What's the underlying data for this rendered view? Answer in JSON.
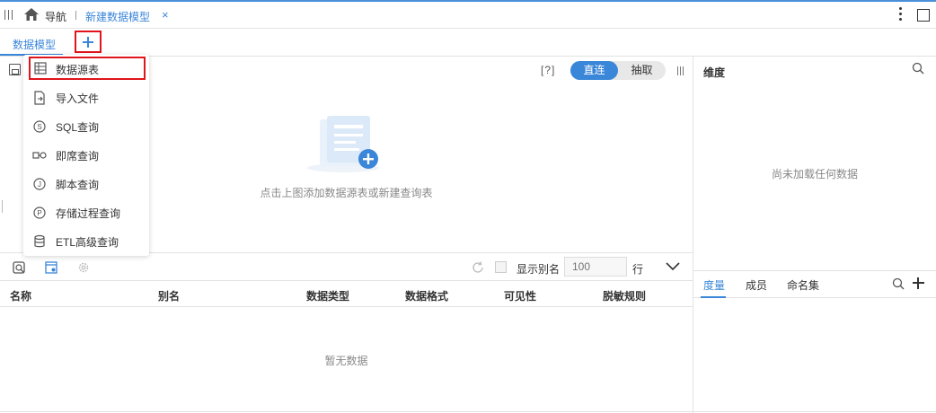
{
  "topbar": {
    "nav_label": "导航",
    "tab_label": "新建数据模型",
    "tab_close": "×"
  },
  "tabrow": {
    "model_tab": "数据模型"
  },
  "canvas": {
    "help": "[?]",
    "mode_direct": "直连",
    "mode_extract": "抽取",
    "empty_hint": "点击上图添加数据源表或新建查询表"
  },
  "dropdown": {
    "items": [
      {
        "label": "数据源表",
        "icon": "table-icon"
      },
      {
        "label": "导入文件",
        "icon": "import-file-icon"
      },
      {
        "label": "SQL查询",
        "icon": "sql-query-icon"
      },
      {
        "label": "即席查询",
        "icon": "adhoc-query-icon"
      },
      {
        "label": "脚本查询",
        "icon": "script-query-icon"
      },
      {
        "label": "存储过程查询",
        "icon": "procedure-query-icon"
      },
      {
        "label": "ETL高级查询",
        "icon": "etl-query-icon"
      }
    ]
  },
  "fields": {
    "show_alias": "显示别名",
    "rows_placeholder": "100",
    "rows_unit": "行",
    "columns": [
      "名称",
      "别名",
      "数据类型",
      "数据格式",
      "可见性",
      "脱敏规则"
    ],
    "no_data": "暂无数据"
  },
  "right_panel": {
    "dimension_title": "维度",
    "dimension_empty": "尚未加载任何数据",
    "tabs": [
      "度量",
      "成员",
      "命名集"
    ]
  },
  "colors": {
    "accent": "#3a86d8",
    "highlight_box": "#e0141c"
  }
}
